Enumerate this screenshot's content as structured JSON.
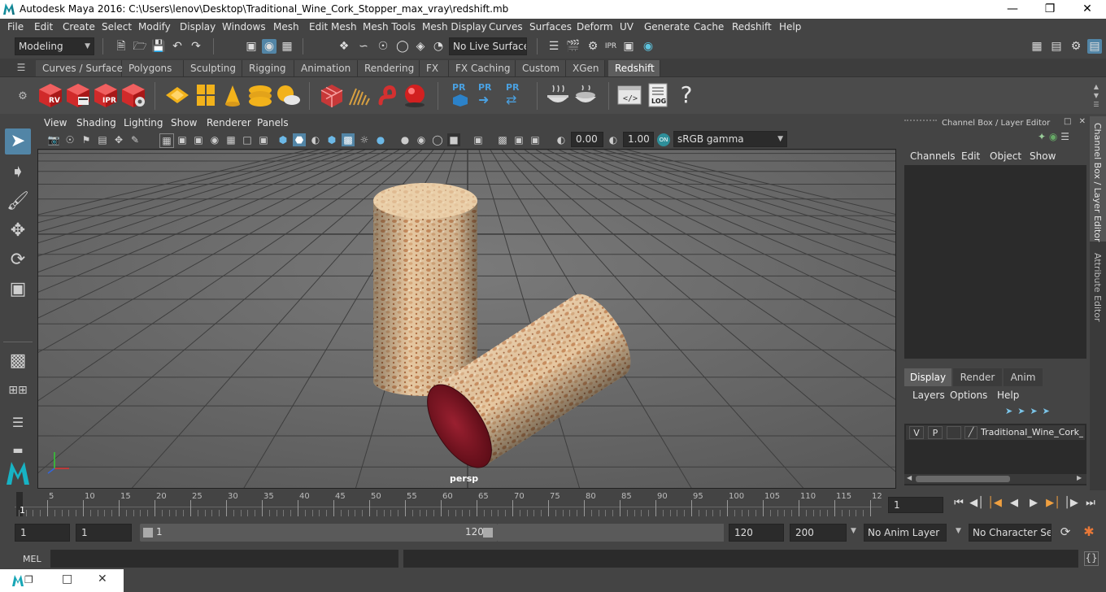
{
  "window": {
    "title": "Autodesk Maya 2016: C:\\Users\\lenov\\Desktop\\Traditional_Wine_Cork_Stopper_max_vray\\redshift.mb"
  },
  "menus": [
    "File",
    "Edit",
    "Create",
    "Select",
    "Modify",
    "Display",
    "Windows",
    "Mesh",
    "Edit Mesh",
    "Mesh Tools",
    "Mesh Display",
    "Curves",
    "Surfaces",
    "Deform",
    "UV",
    "Generate",
    "Cache",
    "Redshift",
    "Help"
  ],
  "status": {
    "mode": "Modeling",
    "live_surface": "No Live Surface"
  },
  "shelf_tabs": [
    "Curves / Surfaces",
    "Polygons",
    "Sculpting",
    "Rigging",
    "Animation",
    "Rendering",
    "FX",
    "FX Caching",
    "Custom",
    "XGen",
    "Redshift"
  ],
  "active_shelf_tab": "Redshift",
  "shelf_labels": {
    "rv": "RV",
    "ipr": "IPR",
    "pr1": "PR",
    "pr2": "PR",
    "pr3": "PR",
    "log": "LOG",
    "help": "?"
  },
  "viewport": {
    "menus": [
      "View",
      "Shading",
      "Lighting",
      "Show",
      "Renderer",
      "Panels"
    ],
    "exposure": "0.00",
    "gamma": "1.00",
    "colorspace": "sRGB gamma",
    "camera_label": "persp"
  },
  "channel_box": {
    "title": "Channel Box / Layer Editor",
    "menus": [
      "Channels",
      "Edit",
      "Object",
      "Show"
    ]
  },
  "layer_editor": {
    "tabs": [
      "Display",
      "Render",
      "Anim"
    ],
    "active_tab": "Display",
    "menus": [
      "Layers",
      "Options",
      "Help"
    ],
    "layer": {
      "v": "V",
      "p": "P",
      "name": "Traditional_Wine_Cork_S"
    }
  },
  "side_tabs": [
    "Channel Box / Layer Editor",
    "Attribute Editor"
  ],
  "timeline": {
    "ticks": [
      "5",
      "10",
      "15",
      "20",
      "25",
      "30",
      "35",
      "40",
      "45",
      "50",
      "55",
      "60",
      "65",
      "70",
      "75",
      "80",
      "85",
      "90",
      "95",
      "100",
      "105",
      "110",
      "115",
      "12"
    ],
    "start_marker": "1",
    "current_frame": "1"
  },
  "range": {
    "start": "1",
    "playback_start": "1",
    "slider_start": "1",
    "slider_end": "120",
    "playback_end": "120",
    "end": "200",
    "anim_layer": "No Anim Layer",
    "character_set": "No Character Set"
  },
  "command": {
    "label": "MEL"
  },
  "colors": {
    "accent": "#5285a6",
    "cork_end": "#8a1c28"
  }
}
